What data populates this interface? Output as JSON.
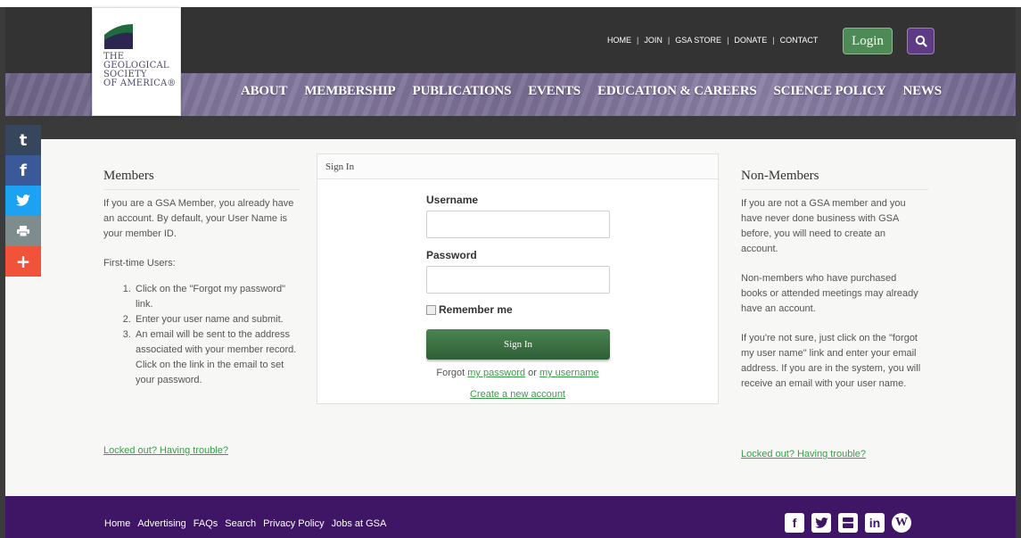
{
  "header": {
    "logo_lines": [
      "THE",
      "GEOLOGICAL",
      "SOCIETY",
      "OF AMERICA®"
    ],
    "utility_links": [
      "HOME",
      "JOIN",
      "GSA STORE",
      "DONATE",
      "CONTACT"
    ],
    "login_label": "Login",
    "main_nav": [
      "ABOUT",
      "MEMBERSHIP",
      "PUBLICATIONS",
      "EVENTS",
      "EDUCATION & CAREERS",
      "SCIENCE POLICY",
      "NEWS"
    ]
  },
  "social": {
    "tumblr": "t",
    "facebook": "f",
    "plus": "+"
  },
  "members": {
    "heading": "Members",
    "intro": "If you are a GSA Member, you already have an account. By default, your User Name is your member ID.",
    "first_time": "First-time Users:",
    "steps": [
      "Click on the \"Forgot my password\" link.",
      "Enter your user name and submit.",
      "An email will be sent to the address associated with your member record. Click on the link in the email to set your password."
    ],
    "help_link": "Locked out? Having trouble?"
  },
  "signin": {
    "heading": "Sign In",
    "username_label": "Username",
    "password_label": "Password",
    "remember_label": "Remember me",
    "button_label": "Sign In",
    "forgot_prefix": "Forgot",
    "forgot_password": "my password",
    "forgot_or": "or",
    "forgot_username": "my username",
    "create_account": "Create a new account"
  },
  "nonmembers": {
    "heading": "Non-Members",
    "p1": "If you are not a GSA member and you have never done business with GSA before, you will need to create an account.",
    "p2": "Non-members who have purchased books or attended meetings may already have an account.",
    "p3": "If you're not sure, just click on the \"forgot my user name\" link and enter your email address. If you are in the system, you will receive an email with your user name.",
    "help_link": "Locked out? Having trouble?"
  },
  "footer": {
    "links": [
      "Home",
      "Advertising",
      "FAQs",
      "Search",
      "Privacy Policy",
      "Jobs at GSA"
    ],
    "icons": {
      "facebook": "f",
      "linkedin": "in",
      "wordpress": "W"
    }
  }
}
